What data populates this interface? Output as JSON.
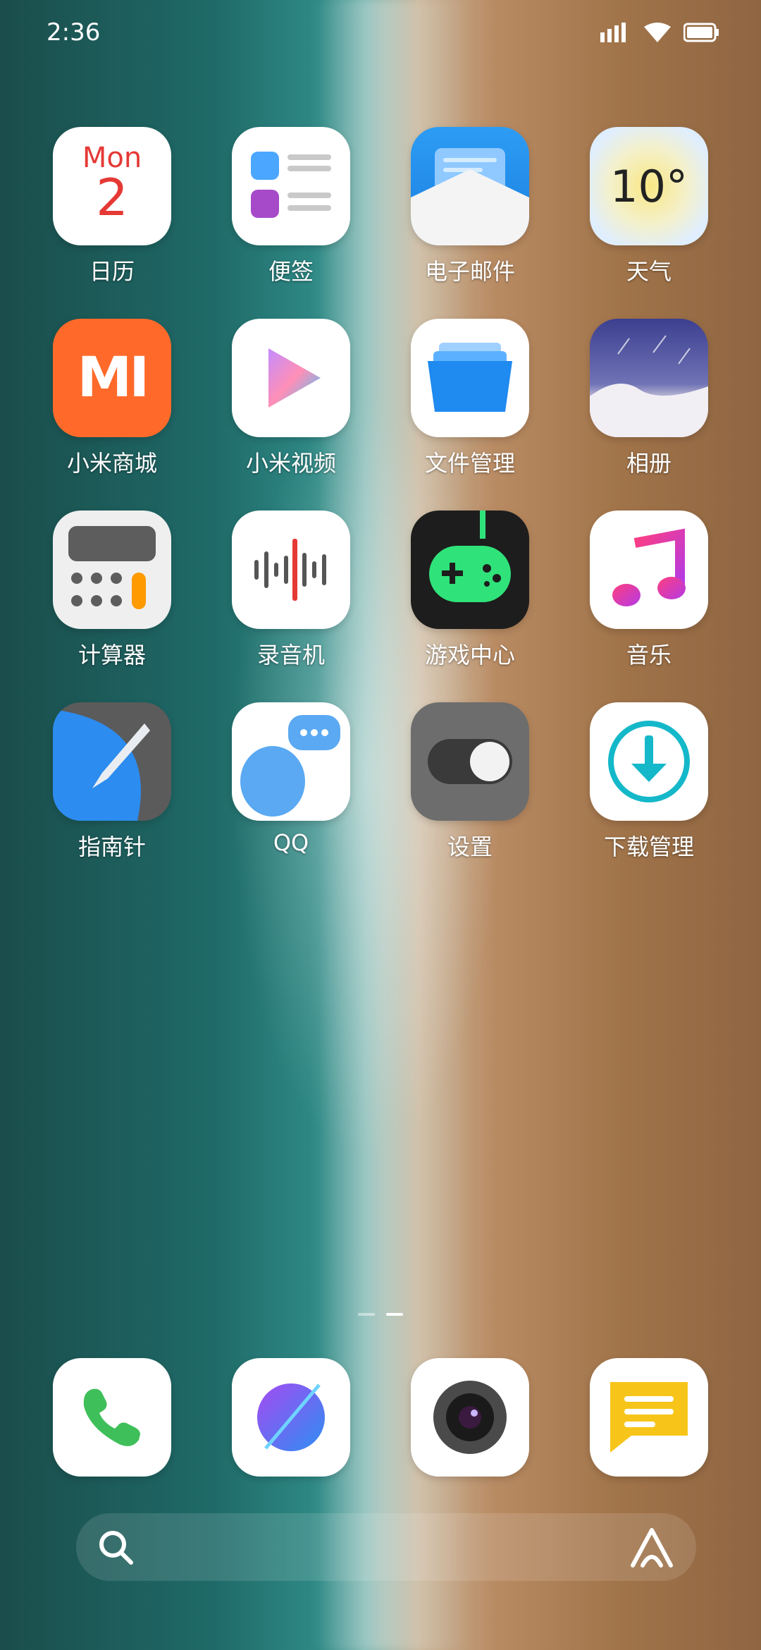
{
  "status": {
    "time": "2:36",
    "icons": [
      "signal-icon",
      "wifi-icon",
      "battery-icon"
    ]
  },
  "apps": [
    {
      "label": "日历",
      "icon": "calendar-icon",
      "calendar": {
        "day": "Mon",
        "date": "2"
      }
    },
    {
      "label": "便签",
      "icon": "notes-icon"
    },
    {
      "label": "电子邮件",
      "icon": "email-icon"
    },
    {
      "label": "天气",
      "icon": "weather-icon",
      "weather": {
        "temp": "10°"
      }
    },
    {
      "label": "小米商城",
      "icon": "mi-store-icon",
      "mi_text": "mi"
    },
    {
      "label": "小米视频",
      "icon": "video-play-icon"
    },
    {
      "label": "文件管理",
      "icon": "folder-icon"
    },
    {
      "label": "相册",
      "icon": "gallery-icon"
    },
    {
      "label": "计算器",
      "icon": "calculator-icon"
    },
    {
      "label": "录音机",
      "icon": "recorder-icon"
    },
    {
      "label": "游戏中心",
      "icon": "gamepad-icon"
    },
    {
      "label": "音乐",
      "icon": "music-icon"
    },
    {
      "label": "指南针",
      "icon": "compass-icon"
    },
    {
      "label": "QQ",
      "icon": "qq-icon"
    },
    {
      "label": "设置",
      "icon": "settings-toggle-icon"
    },
    {
      "label": "下载管理",
      "icon": "download-icon"
    }
  ],
  "dock": [
    {
      "name": "phone",
      "icon": "phone-icon"
    },
    {
      "name": "browser",
      "icon": "browser-icon"
    },
    {
      "name": "camera",
      "icon": "camera-icon"
    },
    {
      "name": "messages",
      "icon": "message-icon"
    }
  ],
  "colors": {
    "calendar_red": "#e53935",
    "mi_orange": "#ff6a2b",
    "game_green": "#2fe37a",
    "music_pink": "#e23fb6",
    "download_cyan": "#14b8c9"
  }
}
